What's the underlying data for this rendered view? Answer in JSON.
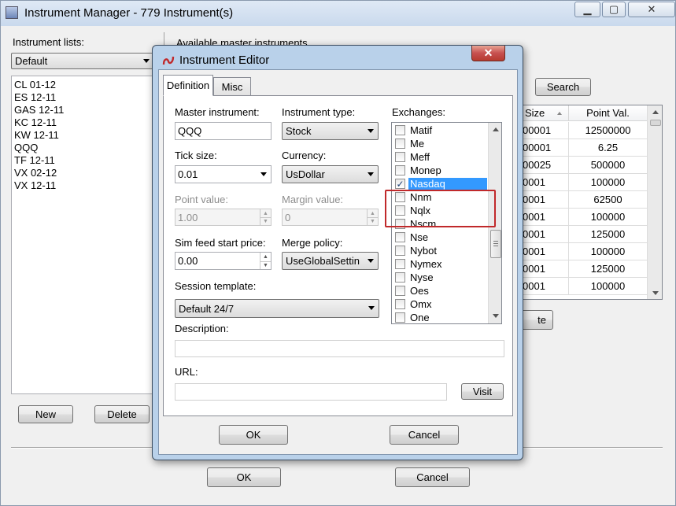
{
  "main_window": {
    "title": "Instrument Manager - 779 Instrument(s)",
    "title_controls": {
      "minimize": "▁",
      "maximize": "▢",
      "close": "✕"
    },
    "instrument_lists_label": "Instrument lists:",
    "selected_list": "Default",
    "instrument_list_items": [
      "CL 01-12",
      "ES 12-11",
      "GAS 12-11",
      "KC 12-11",
      "KW 12-11",
      "QQQ",
      "TF 12-11",
      "VX 02-12",
      "VX 12-11"
    ],
    "new_button": "New",
    "delete_button": "Delete",
    "available_master_label": "Available master instruments",
    "search_button": "Search",
    "grid_columns": [
      "Size",
      "Point Val."
    ],
    "grid_rows": [
      [
        "00001",
        "12500000"
      ],
      [
        "00001",
        "6.25"
      ],
      [
        "00025",
        "500000"
      ],
      [
        "0001",
        "100000"
      ],
      [
        "0001",
        "62500"
      ],
      [
        "0001",
        "100000"
      ],
      [
        "0001",
        "125000"
      ],
      [
        "0001",
        "100000"
      ],
      [
        "0001",
        "125000"
      ],
      [
        "0001",
        "100000"
      ]
    ],
    "partial_button_text": "te",
    "ok_button": "OK",
    "cancel_button": "Cancel"
  },
  "editor": {
    "title": "Instrument Editor",
    "close_glyph": "✕",
    "tabs": [
      "Definition",
      "Misc"
    ],
    "active_tab": "Definition",
    "fields": {
      "master_instrument": {
        "label": "Master instrument:",
        "value": "QQQ"
      },
      "instrument_type": {
        "label": "Instrument type:",
        "value": "Stock"
      },
      "tick_size": {
        "label": "Tick size:",
        "value": "0.01"
      },
      "currency": {
        "label": "Currency:",
        "value": "UsDollar"
      },
      "point_value": {
        "label": "Point value:",
        "value": "1.00"
      },
      "margin_value": {
        "label": "Margin value:",
        "value": "0"
      },
      "sim_feed_start_price": {
        "label": "Sim feed start price:",
        "value": "0.00"
      },
      "merge_policy": {
        "label": "Merge policy:",
        "value": "UseGlobalSettin"
      },
      "session_template": {
        "label": "Session template:",
        "value": "Default 24/7"
      },
      "description": {
        "label": "Description:",
        "value": ""
      },
      "url": {
        "label": "URL:",
        "value": ""
      }
    },
    "exchanges_label": "Exchanges:",
    "exchanges": [
      {
        "name": "Matif",
        "checked": false
      },
      {
        "name": "Me",
        "checked": false
      },
      {
        "name": "Meff",
        "checked": false
      },
      {
        "name": "Monep",
        "checked": false
      },
      {
        "name": "Nasdaq",
        "checked": true
      },
      {
        "name": "Nnm",
        "checked": false
      },
      {
        "name": "Nqlx",
        "checked": false
      },
      {
        "name": "Nscm",
        "checked": false
      },
      {
        "name": "Nse",
        "checked": false
      },
      {
        "name": "Nybot",
        "checked": false
      },
      {
        "name": "Nymex",
        "checked": false
      },
      {
        "name": "Nyse",
        "checked": false
      },
      {
        "name": "Oes",
        "checked": false
      },
      {
        "name": "Omx",
        "checked": false
      },
      {
        "name": "One",
        "checked": false
      }
    ],
    "check_glyph": "✓",
    "visit_button": "Visit",
    "ok_button": "OK",
    "cancel_button": "Cancel"
  },
  "colors": {
    "selection": "#3399ff",
    "highlight_box": "#c0292b",
    "dialog_frame": "#b9d1ea"
  }
}
